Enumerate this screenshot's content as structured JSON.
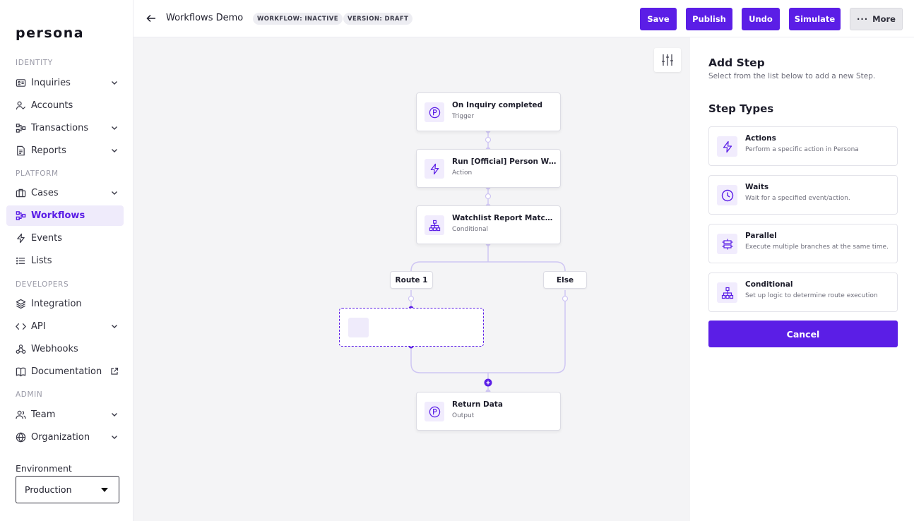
{
  "sidebar": {
    "logo": "persona",
    "sections": {
      "identity": "IDENTITY",
      "platform": "PLATFORM",
      "developers": "DEVELOPERS",
      "admin": "ADMIN"
    },
    "items": [
      {
        "label": "Inquiries",
        "icon": "id-card-icon",
        "chevron": true
      },
      {
        "label": "Accounts",
        "icon": "user-check-icon",
        "chevron": false
      },
      {
        "label": "Transactions",
        "icon": "transactions-icon",
        "chevron": true
      },
      {
        "label": "Reports",
        "icon": "document-icon",
        "chevron": true
      },
      {
        "label": "Cases",
        "icon": "briefcase-icon",
        "chevron": true
      },
      {
        "label": "Workflows",
        "icon": "workflow-icon",
        "chevron": false,
        "active": true
      },
      {
        "label": "Events",
        "icon": "lightning-icon",
        "chevron": false
      },
      {
        "label": "Lists",
        "icon": "list-icon",
        "chevron": false
      },
      {
        "label": "Integration",
        "icon": "layers-icon",
        "chevron": false
      },
      {
        "label": "API",
        "icon": "code-icon",
        "chevron": true
      },
      {
        "label": "Webhooks",
        "icon": "webhook-icon",
        "chevron": false
      },
      {
        "label": "Documentation",
        "icon": "book-icon",
        "chevron": false,
        "external": true
      },
      {
        "label": "Team",
        "icon": "team-icon",
        "chevron": true
      },
      {
        "label": "Organization",
        "icon": "globe-icon",
        "chevron": true
      }
    ],
    "environment_label": "Environment",
    "environment_value": "Production"
  },
  "topbar": {
    "title": "Workflows Demo",
    "badge_status": "WORKFLOW: INACTIVE",
    "badge_version": "VERSION: DRAFT",
    "save": "Save",
    "publish": "Publish",
    "undo": "Undo",
    "simulate": "Simulate",
    "more": "More"
  },
  "canvas": {
    "nodes": {
      "trigger": {
        "title": "On Inquiry completed",
        "subtitle": "Trigger"
      },
      "action": {
        "title": "Run [Official] Person Watchlist",
        "subtitle": "Action"
      },
      "conditional": {
        "title": "Watchlist Report Match, Route",
        "subtitle": "Conditional"
      },
      "output": {
        "title": "Return Data",
        "subtitle": "Output"
      }
    },
    "route1": "Route 1",
    "else": "Else"
  },
  "panel": {
    "title": "Add Step",
    "subtitle": "Select from the list below to add a new Step.",
    "types_title": "Step Types",
    "steps": [
      {
        "title": "Actions",
        "desc": "Perform a specific action in Persona",
        "icon": "lightning-icon"
      },
      {
        "title": "Waits",
        "desc": "Wait for a specified event/action.",
        "icon": "clock-icon"
      },
      {
        "title": "Parallel",
        "desc": "Execute multiple branches at the same time.",
        "icon": "parallel-icon"
      },
      {
        "title": "Conditional",
        "desc": "Set up logic to determine route execution",
        "icon": "branch-icon"
      }
    ],
    "cancel": "Cancel"
  },
  "colors": {
    "accent": "#5b1ee6",
    "accent_light": "#efebfb",
    "canvas_bg": "#f4f4f6"
  }
}
